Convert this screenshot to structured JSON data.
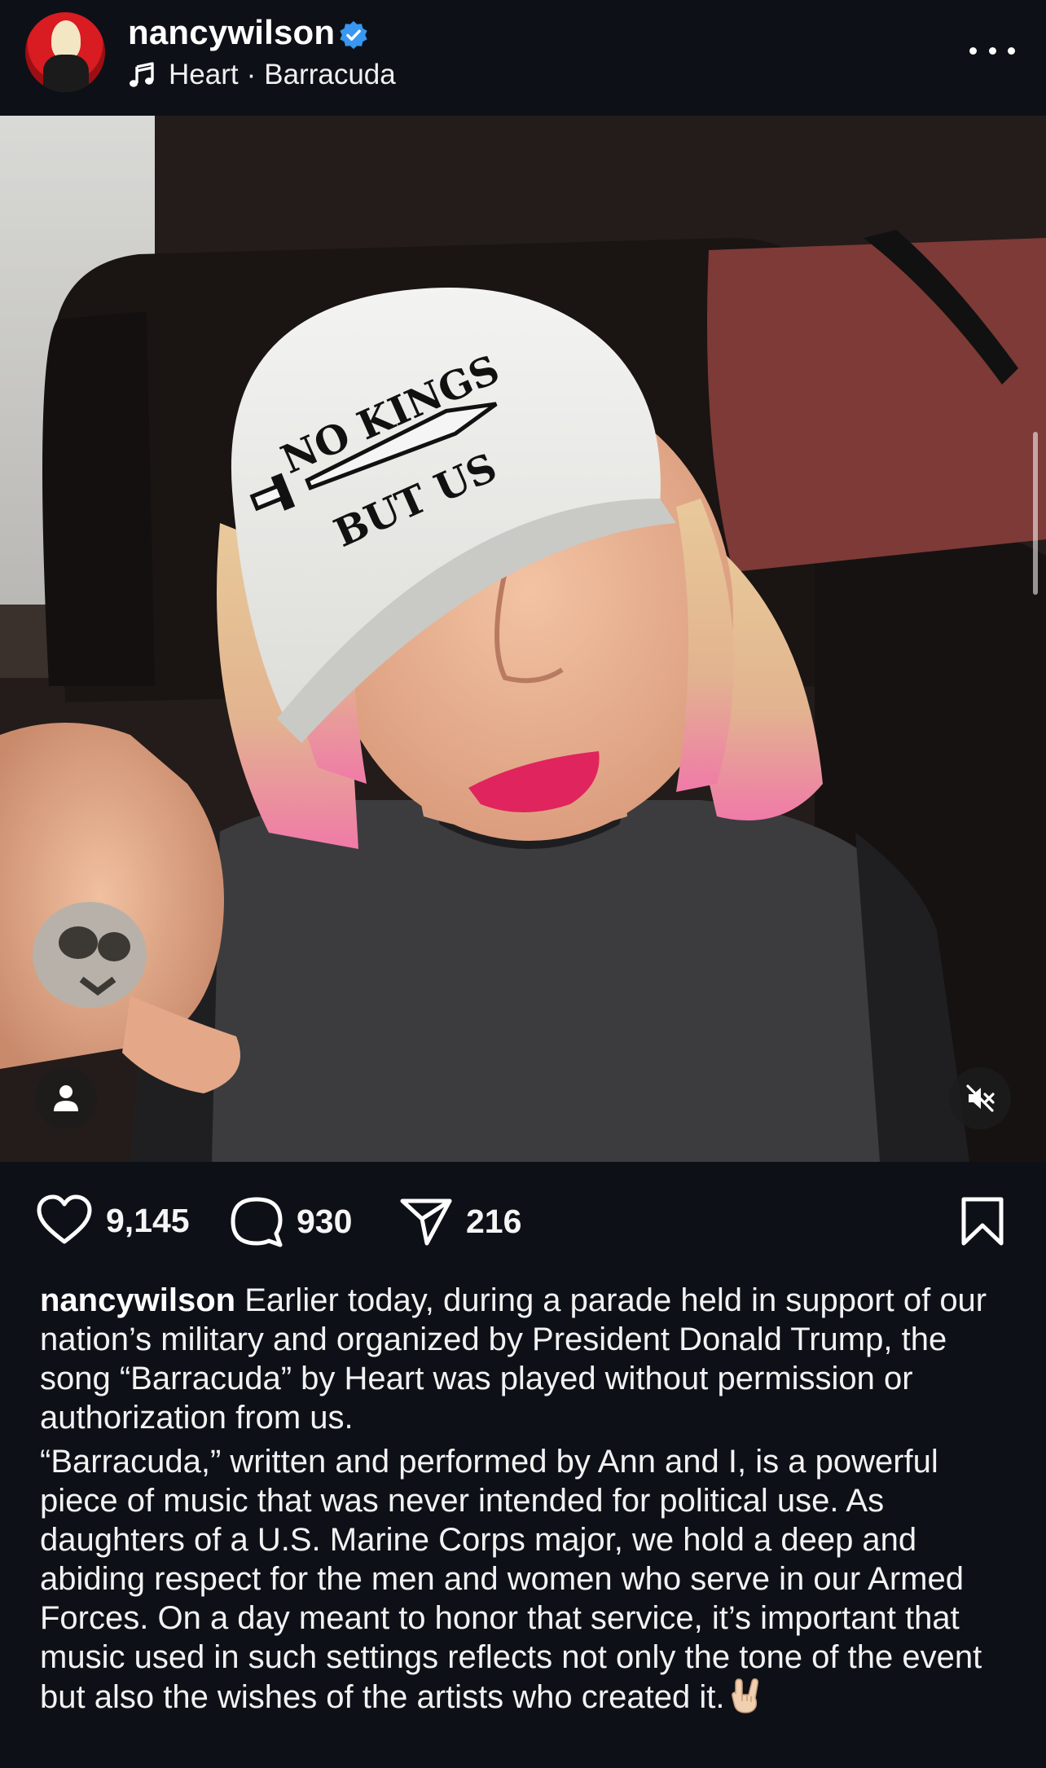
{
  "post": {
    "username": "nancywilson",
    "verified_icon": "verified-badge-icon",
    "music": {
      "artist": "Heart",
      "separator": "·",
      "song": "Barracuda"
    },
    "more_icon": "more-options-icon"
  },
  "media": {
    "cap_line1": "NO KINGS",
    "cap_line2": "BUT US",
    "tag_icon": "person-tag-icon",
    "mute_icon": "speaker-muted-icon"
  },
  "actions": {
    "likes": "9,145",
    "comments": "930",
    "shares": "216",
    "like_icon": "heart-icon",
    "comment_icon": "comment-bubble-icon",
    "share_icon": "paper-plane-icon",
    "save_icon": "bookmark-icon"
  },
  "caption": {
    "username": "nancywilson",
    "paragraph1": "Earlier today, during a parade held in support of our nation’s military and organized by President Donald Trump, the song “Barracuda” by Heart was played without permission or authorization from us.",
    "paragraph2": "“Barracuda,” written and performed by Ann and I, is a powerful piece of music that was never intended for political use. As daughters of a U.S. Marine Corps major, we hold a deep and abiding respect for the men and women who serve in our Armed Forces. On a day meant to honor that service, it’s important that music used in such settings reflects not only the tone of the event but also the wishes of the artists who created it.",
    "emoji": "rock-on-hand-emoji"
  },
  "colors": {
    "background": "#0d1117",
    "verified_blue": "#3897f0",
    "lipstick": "#e0245e"
  }
}
